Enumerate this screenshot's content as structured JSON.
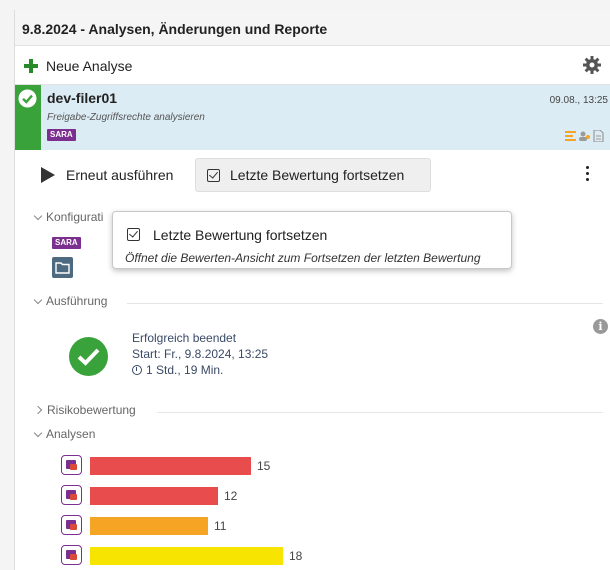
{
  "header": {
    "title": "9.8.2024 - Analysen, Änderungen und Reporte"
  },
  "toolbar": {
    "new_label": "Neue Analyse"
  },
  "entry": {
    "name": "dev-filer01",
    "description": "Freigabe-Zugriffsrechte analysieren",
    "badge": "SARA",
    "date": "09.08., 13:25"
  },
  "actions": {
    "run_label": "Erneut ausführen",
    "continue_label": "Letzte Bewertung fortsetzen"
  },
  "sections": {
    "config": "Konfigurati",
    "config_badge": "SARA",
    "execution": "Ausführung",
    "risk": "Risikobewertung",
    "analyses": "Analysen"
  },
  "status": {
    "title": "Erfolgreich beendet",
    "start": "Start: Fr., 9.8.2024, 13:25",
    "duration": "1 Std., 19 Min."
  },
  "tooltip": {
    "title": "Letzte Bewertung fortsetzen",
    "description": "Öffnet die Bewerten-Ansicht zum Fortsetzen der letzten Bewertung"
  },
  "colors": {
    "red": "#e84c4c",
    "orange": "#f5a423",
    "yellow": "#f7e400",
    "purple": "#7b2f8e",
    "green": "#3aa23a"
  },
  "chart_data": {
    "type": "bar",
    "orientation": "horizontal",
    "values": [
      15,
      12,
      11,
      18
    ],
    "bar_colors": [
      "#e84c4c",
      "#e84c4c",
      "#f5a423",
      "#f7e400"
    ]
  }
}
